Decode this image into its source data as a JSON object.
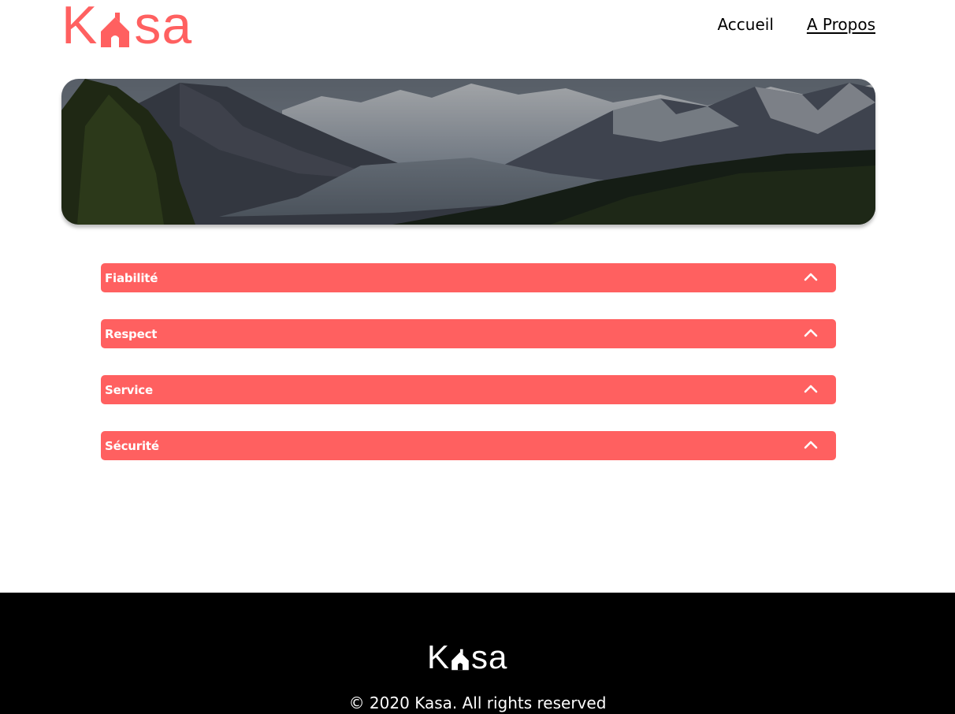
{
  "brand": {
    "logo_k": "K",
    "logo_sa": "sa",
    "accent_color": "#FF6060"
  },
  "nav": {
    "items": [
      {
        "label": "Accueil",
        "active": false
      },
      {
        "label": "A Propos",
        "active": true
      }
    ]
  },
  "banner": {
    "image": "mountain-valley-landscape"
  },
  "collapses": [
    {
      "title": "Fiabilité",
      "icon": "chevron-up-icon"
    },
    {
      "title": "Respect",
      "icon": "chevron-up-icon"
    },
    {
      "title": "Service",
      "icon": "chevron-up-icon"
    },
    {
      "title": "Sécurité",
      "icon": "chevron-up-icon"
    }
  ],
  "footer": {
    "logo_k": "K",
    "logo_sa": "sa",
    "copyright": "© 2020 Kasa. All rights reserved"
  }
}
